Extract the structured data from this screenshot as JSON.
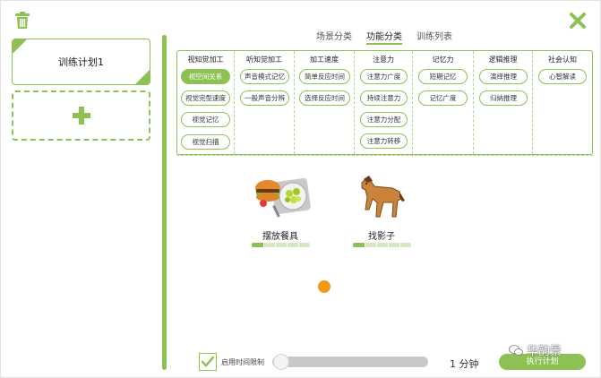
{
  "colors": {
    "accent": "#8dc153",
    "accent_light": "#d6e8c1",
    "orange_dot": "#f39a14"
  },
  "icons": {
    "delete": "trash-icon",
    "close": "close-x-icon",
    "add": "plus-icon"
  },
  "sidebar": {
    "plans": [
      {
        "label": "训练计划1"
      }
    ]
  },
  "tabs": [
    {
      "label": "场景分类",
      "active": false
    },
    {
      "label": "功能分类",
      "active": true
    },
    {
      "label": "训练列表",
      "active": false
    }
  ],
  "categories": [
    {
      "title": "视知觉加工",
      "items": [
        "视空间关系",
        "视觉完型速度",
        "视觉记忆",
        "视觉扫描"
      ],
      "active_index": 0
    },
    {
      "title": "听知觉加工",
      "items": [
        "声音模式记忆",
        "一般声音分辨"
      ]
    },
    {
      "title": "加工速度",
      "items": [
        "简单反应时间",
        "选择反应时间"
      ]
    },
    {
      "title": "注意力",
      "items": [
        "注意力广度",
        "持续注意力",
        "注意力分配",
        "注意力转移"
      ]
    },
    {
      "title": "记忆力",
      "items": [
        "短期记忆",
        "记忆广度"
      ]
    },
    {
      "title": "逻辑推理",
      "items": [
        "演绎推理",
        "归纳推理"
      ]
    },
    {
      "title": "社会认知",
      "items": [
        "心智解读"
      ]
    }
  ],
  "games": [
    {
      "name": "摆放餐具",
      "icon": "tableware-plate-icon",
      "progress_level": 0.2
    },
    {
      "name": "找影子",
      "icon": "horse-icon",
      "progress_level": 0.2
    }
  ],
  "bottom": {
    "time_limit_label": "启用时间限制",
    "time_limit_checked": true,
    "minutes_text": "1 分钟",
    "execute_label": "执行计划"
  },
  "watermark": {
    "text": "华韵景",
    "icon": "wechat-icon"
  }
}
